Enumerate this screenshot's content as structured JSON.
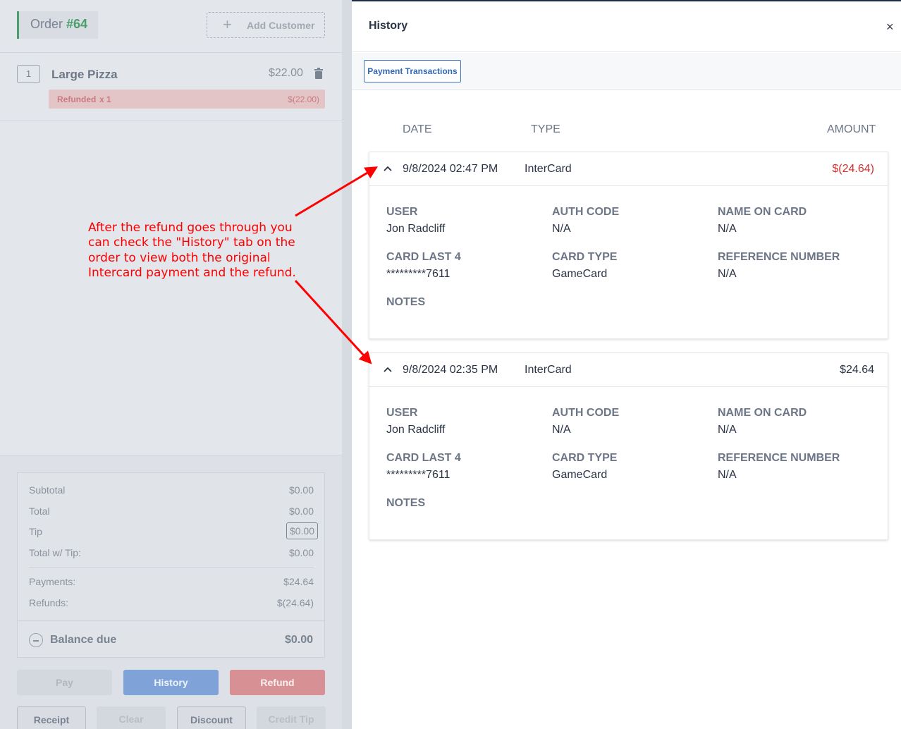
{
  "order": {
    "label": "Order",
    "number": "#64",
    "add_customer": "Add Customer",
    "items": [
      {
        "qty": "1",
        "name": "Large Pizza",
        "price": "$22.00",
        "refund_label": "Refunded",
        "refund_qty": "x 1",
        "refund_amount": "$(22.00)"
      }
    ]
  },
  "totals": {
    "subtotal_label": "Subtotal",
    "subtotal": "$0.00",
    "total_label": "Total",
    "total": "$0.00",
    "tip_label": "Tip",
    "tip": "$0.00",
    "total_tip_label": "Total w/ Tip:",
    "total_tip": "$0.00",
    "payments_label": "Payments:",
    "payments": "$24.64",
    "refunds_label": "Refunds:",
    "refunds": "$(24.64)",
    "balance_label": "Balance due",
    "balance": "$0.00"
  },
  "actions": {
    "pay": "Pay",
    "history": "History",
    "refund": "Refund",
    "receipt": "Receipt",
    "clear": "Clear",
    "discount": "Discount",
    "credit_tip": "Credit Tip"
  },
  "history": {
    "title": "History",
    "close": "×",
    "tab": "Payment Transactions",
    "columns": {
      "date": "DATE",
      "type": "TYPE",
      "amount": "AMOUNT"
    },
    "field_labels": {
      "user": "USER",
      "auth_code": "AUTH CODE",
      "name_on_card": "NAME ON CARD",
      "card_last4": "CARD LAST 4",
      "card_type": "CARD TYPE",
      "reference": "REFERENCE NUMBER",
      "notes": "NOTES"
    },
    "transactions": [
      {
        "date": "9/8/2024 02:47 PM",
        "type": "InterCard",
        "amount": "$(24.64)",
        "user": "Jon Radcliff",
        "auth_code": "N/A",
        "name_on_card": "N/A",
        "card_last4": "*********7611",
        "card_type": "GameCard",
        "reference": "N/A",
        "notes": ""
      },
      {
        "date": "9/8/2024 02:35 PM",
        "type": "InterCard",
        "amount": "$24.64",
        "user": "Jon Radcliff",
        "auth_code": "N/A",
        "name_on_card": "N/A",
        "card_last4": "*********7611",
        "card_type": "GameCard",
        "reference": "N/A",
        "notes": ""
      }
    ]
  },
  "annotation": {
    "text": "After the refund goes through you can check the \"History\" tab on the order to view both the original Intercard payment and the refund.",
    "color": "#ff0000"
  },
  "colors": {
    "accent_green": "#4a9e6c",
    "refund_red": "#d32f2f",
    "primary_blue": "#2f67b9"
  }
}
